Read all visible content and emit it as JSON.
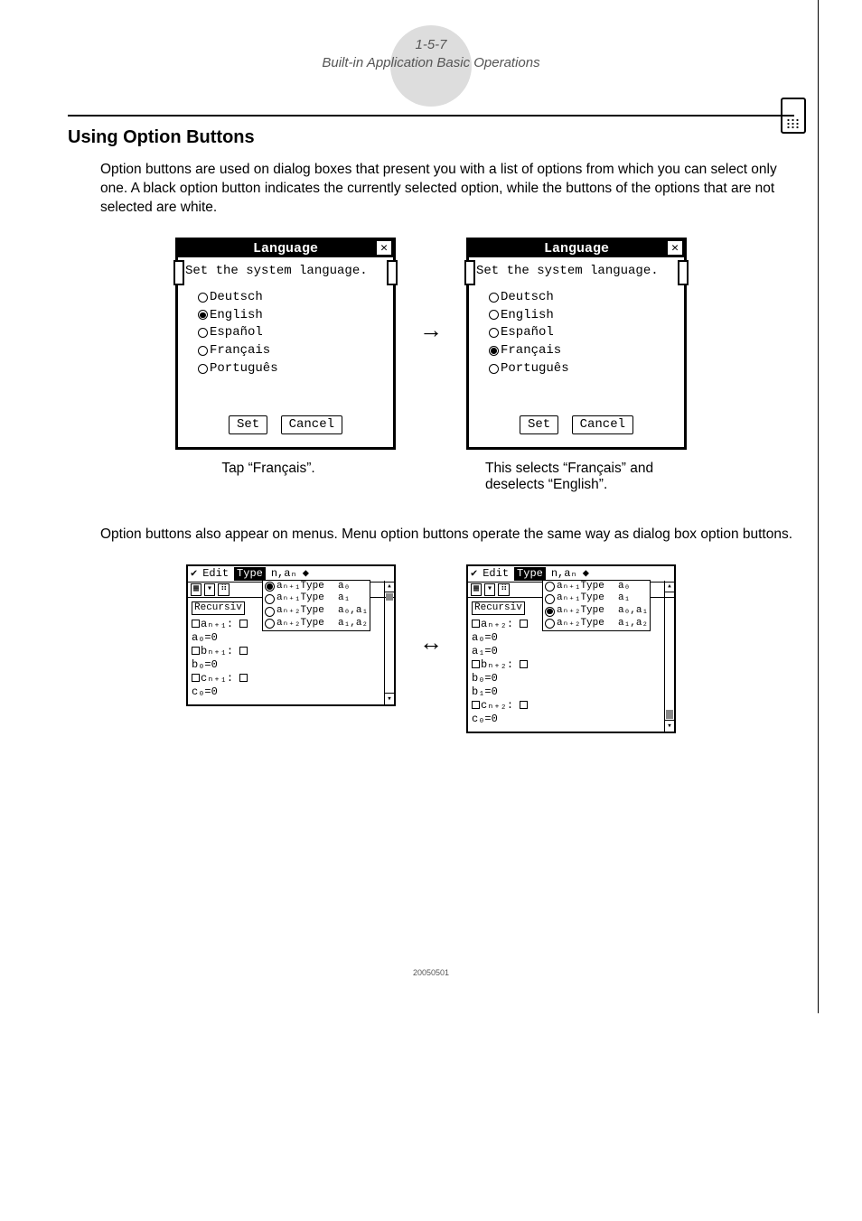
{
  "header": {
    "section_number": "1-5-7",
    "section_title": "Built-in Application Basic Operations"
  },
  "heading": "Using Option Buttons",
  "paragraph1": "Option buttons are used on dialog boxes that present you with a list of options from which you can select only one. A black option button indicates the currently selected option, while the buttons of the options that are not selected are white.",
  "dialog": {
    "title": "Language",
    "close": "✕",
    "prompt": "Set the system language.",
    "options": [
      "Deutsch",
      "English",
      "Español",
      "Français",
      "Português"
    ],
    "selected_left": "English",
    "selected_right": "Français",
    "btn_set": "Set",
    "btn_cancel": "Cancel"
  },
  "caption_left": "Tap “Français”.",
  "caption_right": "This selects “Français” and deselects “English”.",
  "paragraph2": "Option buttons also appear on menus. Menu option buttons operate the same way as dialog box option buttons.",
  "menu": {
    "menubar_items": [
      "✔",
      "Edit",
      "Type",
      "n,aₙ",
      "◆"
    ],
    "highlighted": "Type",
    "toolbar_recursiv": "Recursiv",
    "popup_rows": [
      {
        "label": "aₙ₊₁Type",
        "rhs": "a₀"
      },
      {
        "label": "aₙ₊₁Type",
        "rhs": "a₁"
      },
      {
        "label": "aₙ₊₂Type",
        "rhs": "a₀,a₁"
      },
      {
        "label": "aₙ₊₂Type",
        "rhs": "a₁,a₂"
      }
    ],
    "popup_selected_left": 0,
    "popup_selected_right": 2,
    "body_left": [
      "□aₙ₊₁: □",
      "   a₀=0",
      "□bₙ₊₁: □",
      "   b₀=0",
      "□cₙ₊₁: □",
      "   c₀=0"
    ],
    "body_right": [
      "□aₙ₊₂: □",
      "   a₀=0",
      "   a₁=0",
      "□bₙ₊₂: □",
      "   b₀=0",
      "   b₁=0",
      "□cₙ₊₂: □",
      "   c₀=0"
    ]
  },
  "arrow_right": "→",
  "arrow_bi": "↔",
  "footer": "20050501"
}
